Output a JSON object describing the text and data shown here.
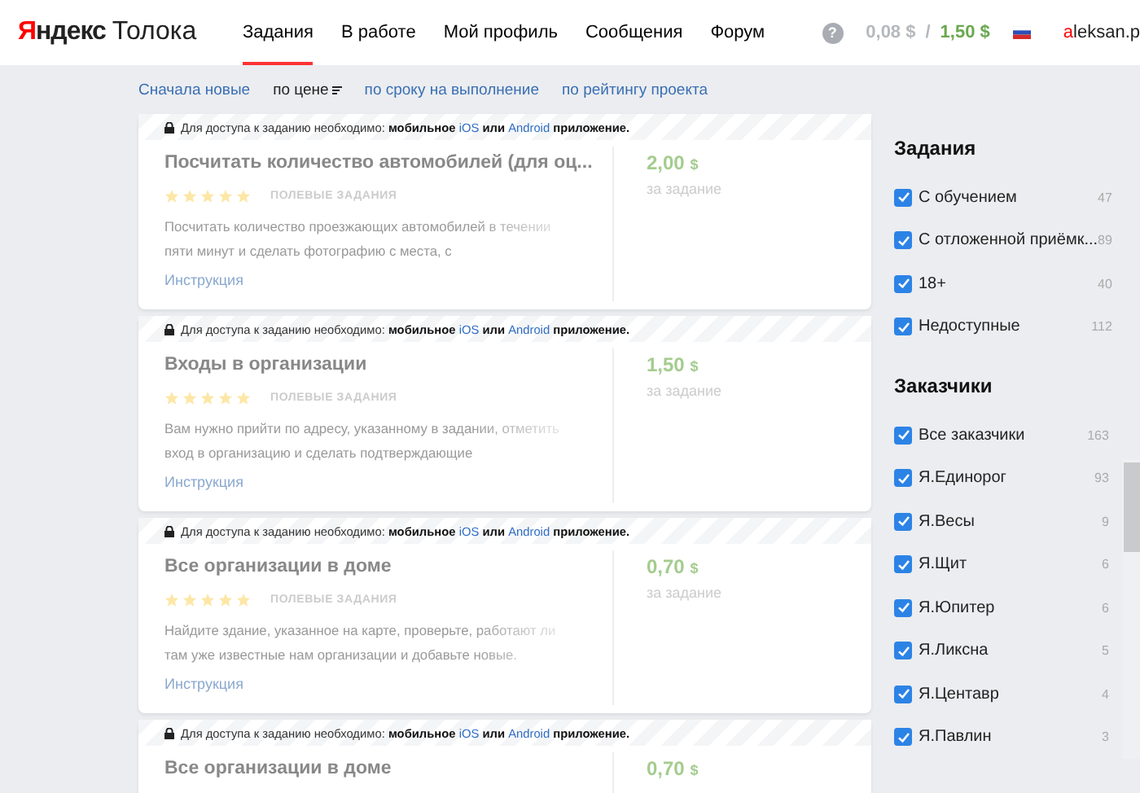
{
  "header": {
    "logo": {
      "brand": "Яндекс",
      "product": "Толока"
    },
    "nav": [
      {
        "label": "Задания",
        "selected": true
      },
      {
        "label": "В работе",
        "selected": false
      },
      {
        "label": "Мой профиль",
        "selected": false
      },
      {
        "label": "Сообщения",
        "selected": false
      },
      {
        "label": "Форум",
        "selected": false
      }
    ],
    "help": "?",
    "balance": {
      "pending": "0,08 $",
      "separator": "/",
      "available": "1,50 $"
    },
    "user": "aleksan.p"
  },
  "sort": [
    {
      "label": "Сначала новые",
      "selected": false
    },
    {
      "label": "по цене",
      "selected": true
    },
    {
      "label": "по сроку на выполнение",
      "selected": false
    },
    {
      "label": "по рейтингу проекта",
      "selected": false
    }
  ],
  "tasks": [
    {
      "notice": {
        "before": "Для доступа к заданию необходимо:",
        "mobile": "мобильное",
        "ios": "iOS",
        "or": "или",
        "android": "Android",
        "after": "приложение."
      },
      "title": "Посчитать количество автомобилей (для оц...",
      "stars": 5,
      "category": "ПОЛЕВЫЕ ЗАДАНИЯ",
      "description": "Посчитать количество проезжающих автомобилей в течении пяти минут и сделать фотографию с места, с",
      "link": "Инструкция",
      "price": "2,00",
      "currency": "$",
      "price_note": "за задание"
    },
    {
      "notice": {
        "before": "Для доступа к заданию необходимо:",
        "mobile": "мобильное",
        "ios": "iOS",
        "or": "или",
        "android": "Android",
        "after": "приложение."
      },
      "title": "Входы в организации",
      "stars": 5,
      "category": "ПОЛЕВЫЕ ЗАДАНИЯ",
      "description": "Вам нужно прийти по адресу, указанному в задании, отметить вход в организацию и сделать подтверждающие",
      "link": "Инструкция",
      "price": "1,50",
      "currency": "$",
      "price_note": "за задание"
    },
    {
      "notice": {
        "before": "Для доступа к заданию необходимо:",
        "mobile": "мобильное",
        "ios": "iOS",
        "or": "или",
        "android": "Android",
        "after": "приложение."
      },
      "title": "Все организации в доме",
      "stars": 5,
      "category": "ПОЛЕВЫЕ ЗАДАНИЯ",
      "description": "Найдите здание, указанное на карте, проверьте, работают ли там уже известные нам организации и добавьте новые.",
      "link": "Инструкция",
      "price": "0,70",
      "currency": "$",
      "price_note": "за задание"
    },
    {
      "notice": {
        "before": "Для доступа к заданию необходимо:",
        "mobile": "мобильное",
        "ios": "iOS",
        "or": "или",
        "android": "Android",
        "after": "приложение."
      },
      "title": "Все организации в доме",
      "price": "0,70",
      "currency": "$"
    }
  ],
  "filters": [
    {
      "title": "Задания",
      "scroll": false,
      "items": [
        {
          "label": "С обучением",
          "count": "47",
          "checked": true
        },
        {
          "label": "С отложенной приёмк...",
          "count": "89",
          "checked": true
        },
        {
          "label": "18+",
          "count": "40",
          "checked": true
        },
        {
          "label": "Недоступные",
          "count": "112",
          "checked": true
        }
      ]
    },
    {
      "title": "Заказчики",
      "scroll": true,
      "items": [
        {
          "label": "Все заказчики",
          "count": "163",
          "checked": true
        },
        {
          "label": "Я.Единорог",
          "count": "93",
          "checked": true
        },
        {
          "label": "Я.Весы",
          "count": "9",
          "checked": true
        },
        {
          "label": "Я.Щит",
          "count": "6",
          "checked": true
        },
        {
          "label": "Я.Юпитер",
          "count": "6",
          "checked": true
        },
        {
          "label": "Я.Ликсна",
          "count": "5",
          "checked": true
        },
        {
          "label": "Я.Центавр",
          "count": "4",
          "checked": true
        },
        {
          "label": "Я.Павлин",
          "count": "3",
          "checked": true
        }
      ]
    }
  ]
}
